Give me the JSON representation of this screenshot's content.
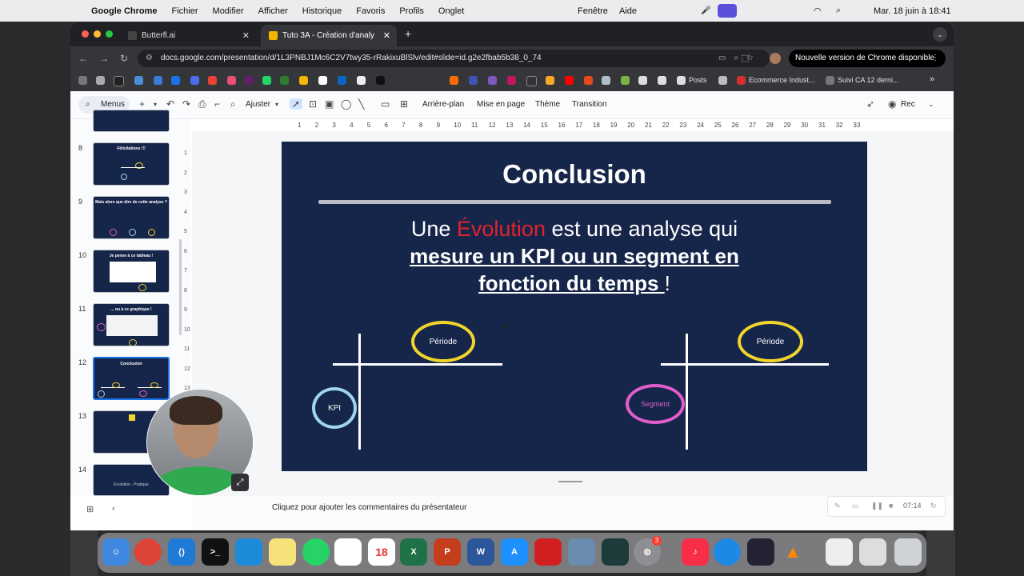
{
  "menubar": {
    "apple": "",
    "app": "Google Chrome",
    "items": [
      "Fichier",
      "Modifier",
      "Afficher",
      "Historique",
      "Favoris",
      "Profils",
      "Onglet"
    ],
    "window_items": [
      "Fenêtre",
      "Aide"
    ],
    "clock": "Mar. 18 juin à 18:41"
  },
  "tabs": [
    {
      "label": "Butterfl.ai",
      "close": "✕"
    },
    {
      "label": "Tuto 3A - Création d'analy",
      "close": "✕"
    }
  ],
  "new_tab": "+",
  "tab_menu": "⌄",
  "address": {
    "back": "←",
    "forward": "→",
    "reload": "↻",
    "url": "docs.google.com/presentation/d/1L3PNBJ1Mc6C2V7twy35-rRakixuBlSlv/edit#slide=id.g2e2fbab5b38_0_74",
    "chrome_update": "Nouvelle version de Chrome disponible",
    "menu": "⋮"
  },
  "bookmarks": {
    "posts": "Posts",
    "ecommerce": "Ecommerce Indust...",
    "suivi": "Suivi CA 12 derni...",
    "more": "»"
  },
  "toolbar": {
    "menus": "Menus",
    "ajuster": "Ajuster",
    "arriere_plan": "Arrière-plan",
    "mise_en_page": "Mise en page",
    "theme": "Thème",
    "transition": "Transition",
    "rec": "Rec"
  },
  "slides": [
    {
      "num": "8",
      "title": "Félicitations !!!"
    },
    {
      "num": "9",
      "title": "Mais alors que dire de cette analyse ?"
    },
    {
      "num": "10",
      "title": "Je pense à ce tableau !"
    },
    {
      "num": "11",
      "title": "... ou à ce graphique !"
    },
    {
      "num": "12",
      "title": "Conclusion"
    },
    {
      "num": "13",
      "title": ""
    },
    {
      "num": "14",
      "title": "Evolution - Pratique"
    }
  ],
  "ruler_top": [
    "1",
    "2",
    "3",
    "4",
    "5",
    "6",
    "7",
    "8",
    "9",
    "10",
    "11",
    "12",
    "13",
    "14",
    "15",
    "16",
    "17",
    "18",
    "19",
    "20",
    "21",
    "22",
    "23",
    "24",
    "25",
    "26",
    "27",
    "28",
    "29",
    "30",
    "31",
    "32",
    "33"
  ],
  "ruler_left": [
    "1",
    "2",
    "3",
    "4",
    "5",
    "6",
    "7",
    "8",
    "9",
    "10",
    "11",
    "12",
    "13",
    "14"
  ],
  "slide": {
    "title": "Conclusion",
    "line1_a": "Une ",
    "line1_red": "Évolution",
    "line1_b": " est une analyse qui",
    "line2": "mesure un KPI ou un segment en",
    "line3_bold": "fonction du temps ",
    "line3_end": "!",
    "left_periode": "Période",
    "kpi": "KPI",
    "right_periode": "Période",
    "segment": "Segment",
    "colors": {
      "yellow": "#f2d52c",
      "blue": "#9fd3f0",
      "pink": "#e05ec9",
      "red": "#e0242a",
      "bg": "#16254a"
    }
  },
  "notes": {
    "placeholder": "Cliquez pour ajouter les commentaires du présentateur"
  },
  "recording": {
    "time": "07:14"
  }
}
